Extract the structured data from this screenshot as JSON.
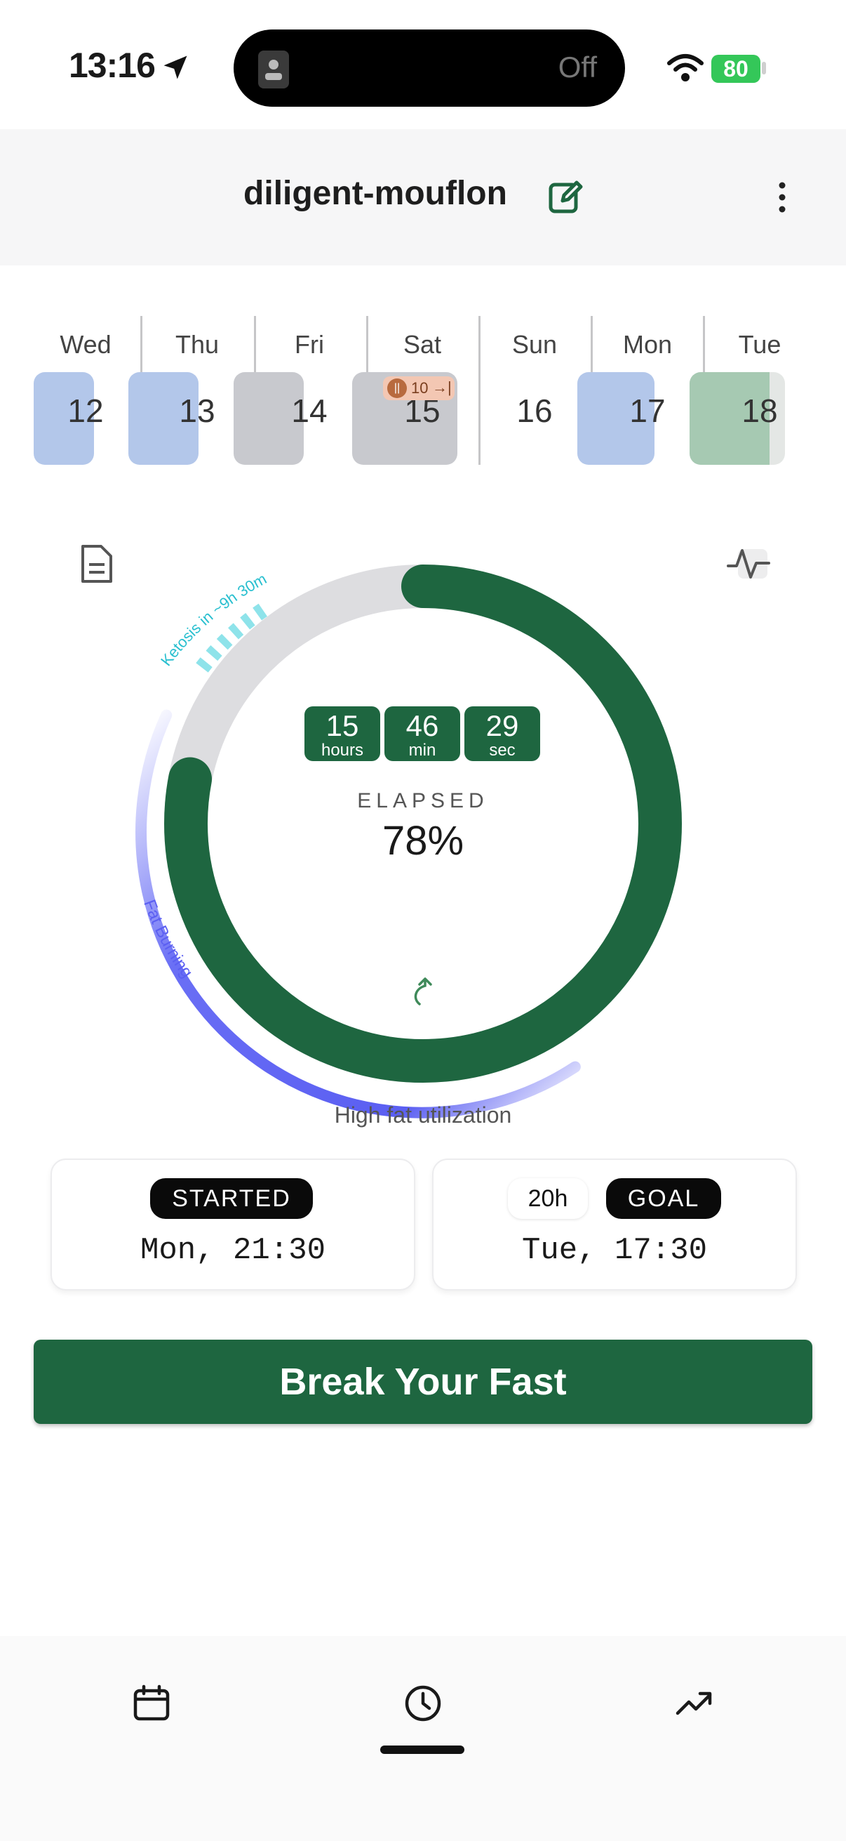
{
  "status_bar": {
    "time": "13:16",
    "island_label": "Off",
    "battery": "80"
  },
  "header": {
    "title": "diligent-mouflon"
  },
  "week": [
    {
      "name": "Wed",
      "num": "12"
    },
    {
      "name": "Thu",
      "num": "13"
    },
    {
      "name": "Fri",
      "num": "14"
    },
    {
      "name": "Sat",
      "num": "15",
      "badge": "10"
    },
    {
      "name": "Sun",
      "num": "16"
    },
    {
      "name": "Mon",
      "num": "17"
    },
    {
      "name": "Tue",
      "num": "18"
    }
  ],
  "dial": {
    "hours": "15",
    "hours_unit": "hours",
    "min": "46",
    "min_unit": "min",
    "sec": "29",
    "sec_unit": "sec",
    "elapsed_label": "ELAPSED",
    "percent": "78%",
    "progress": 0.78,
    "ketosis_label": "Ketosis in ~9h 30m",
    "fat_label": "Fat Burning",
    "phase": "High fat utilization"
  },
  "cards": {
    "started_label": "STARTED",
    "started_time": "Mon, 21:30",
    "goal_hours": "20h",
    "goal_label": "GOAL",
    "goal_time": "Tue, 17:30"
  },
  "actions": {
    "break_fast": "Break Your Fast"
  },
  "colors": {
    "primary": "#1e6640",
    "fat_burning": "#5b5ff2",
    "ketosis": "#8ee3ea",
    "track": "#dddde0"
  },
  "icons": [
    "location-arrow-icon",
    "wifi-icon",
    "edit-icon",
    "more-vertical-icon",
    "document-icon",
    "pulse-icon",
    "reset-icon",
    "calendar-icon",
    "clock-icon",
    "trend-icon"
  ]
}
